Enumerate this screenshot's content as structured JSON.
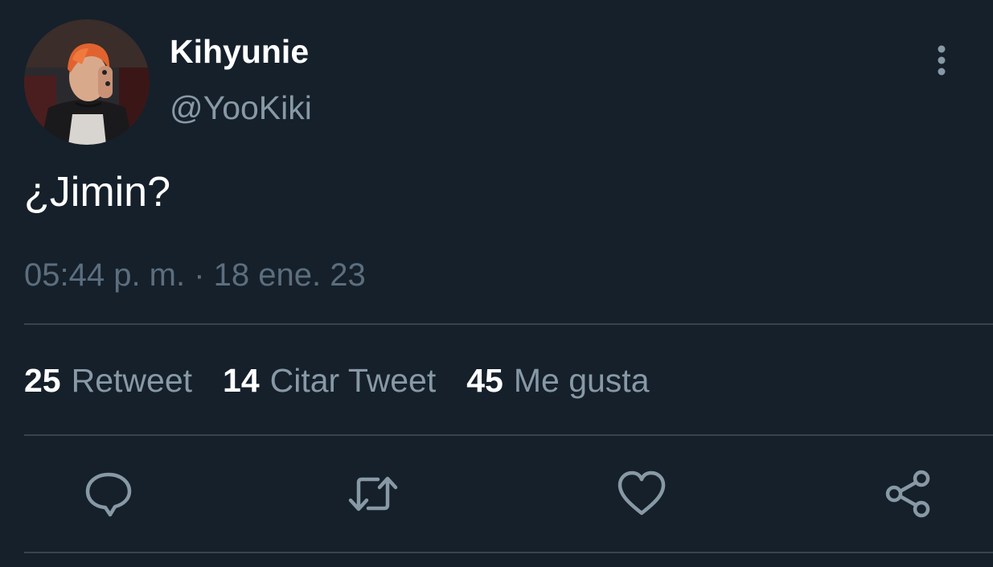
{
  "colors": {
    "background": "#15202b",
    "primary_text": "#ffffff",
    "secondary_text": "#8899a6",
    "timestamp_text": "#5c6e7e",
    "divider": "#38444d",
    "icon": "#8899a6"
  },
  "author": {
    "display_name": "Kihyunie",
    "handle": "@YooKiki",
    "avatar": "profile-photo"
  },
  "tweet": {
    "text": "¿Jimin?",
    "timestamp": "05:44 p. m. · 18 ene. 23"
  },
  "stats": [
    {
      "count": "25",
      "label": "Retweet"
    },
    {
      "count": "14",
      "label": "Citar Tweet"
    },
    {
      "count": "45",
      "label": "Me gusta"
    }
  ],
  "actions": [
    {
      "icon": "reply-icon"
    },
    {
      "icon": "retweet-icon"
    },
    {
      "icon": "like-heart-icon"
    },
    {
      "icon": "share-icon"
    }
  ],
  "menu": {
    "icon": "more-vertical-icon"
  }
}
